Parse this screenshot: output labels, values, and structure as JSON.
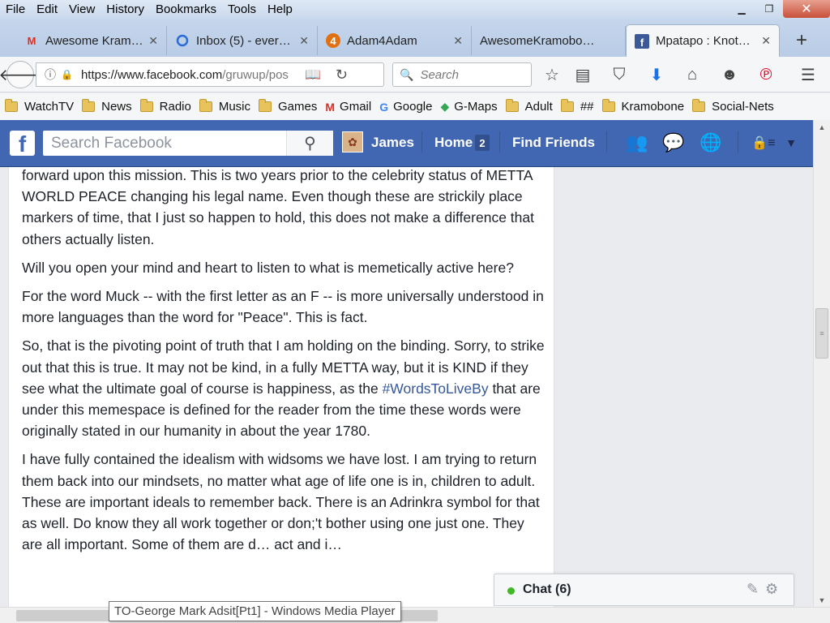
{
  "browser": {
    "menu": [
      "File",
      "Edit",
      "View",
      "History",
      "Bookmarks",
      "Tools",
      "Help"
    ],
    "tabs": [
      {
        "title": "Awesome Kram…",
        "icon": "gmail-icon",
        "icon_text": "M",
        "icon_color": "#d93025",
        "active": false
      },
      {
        "title": "Inbox (5) - ever…",
        "icon": "mail-ring-icon",
        "icon_text": "◯",
        "icon_color": "#2a6bd6",
        "active": false
      },
      {
        "title": "Adam4Adam",
        "icon": "adam4adam-icon",
        "icon_text": "4",
        "icon_color": "#e07010",
        "active": false
      },
      {
        "title": "AwesomeKramobo…",
        "icon": "",
        "icon_text": "",
        "icon_color": "",
        "active": false
      },
      {
        "title": "Mpatapo : Knot…",
        "icon": "facebook-icon",
        "icon_text": "f",
        "icon_color": "#3b5998",
        "active": true
      }
    ],
    "new_tab": "+",
    "url_main": "https://www.facebook.com",
    "url_rest": "/gruwup/pos",
    "search_placeholder": "Search",
    "bookmarks": [
      {
        "label": "WatchTV",
        "type": "folder"
      },
      {
        "label": "News",
        "type": "folder"
      },
      {
        "label": "Radio",
        "type": "folder"
      },
      {
        "label": "Music",
        "type": "folder"
      },
      {
        "label": "Games",
        "type": "folder"
      },
      {
        "label": "Gmail",
        "type": "gmail"
      },
      {
        "label": "Google",
        "type": "google"
      },
      {
        "label": "G-Maps",
        "type": "maps"
      },
      {
        "label": "Adult",
        "type": "folder"
      },
      {
        "label": "##",
        "type": "folder"
      },
      {
        "label": "Kramobone",
        "type": "folder"
      },
      {
        "label": "Social-Nets",
        "type": "folder"
      }
    ]
  },
  "facebook": {
    "search_placeholder": "Search Facebook",
    "user_name": "James",
    "home_label": "Home",
    "home_count": "2",
    "find_friends": "Find Friends",
    "brand_color": "#4267b2"
  },
  "post": {
    "paragraphs": [
      {
        "text": "forward upon this mission. This is two years prior to the celebrity status of METTA WORLD PEACE changing his legal name. Even though these are strickily place markers of time, that I just so happen to hold, this does not make a difference that others actually listen."
      },
      {
        "text": "Will you open your mind and heart to listen to what is memetically active here?"
      },
      {
        "text": "For the word Muck -- with the first letter as an F -- is more universally understood in more languages than the word for \"Peace\". This is fact."
      },
      {
        "before": "So, that is the pivoting point of truth that I am holding on the binding. Sorry, to strike out that this is true. It may not be kind, in a fully METTA way, but it is KIND if they see what the ultimate goal of course is happiness, as the ",
        "hashtag": "#WordsToLiveBy",
        "after": " that are under this memespace is defined for the reader from the time these words were originally stated in our humanity in about the year 1780."
      },
      {
        "text": "I have fully contained the idealism with widsoms we have lost. I am trying to return them back into our mindsets, no matter what age of life one is in, children to adult. These are important ideals to remember back. There is an Adrinkra symbol for that as well. Do know they all work together or don;'t bother using one just one. They are all important. Some of them are d… act and i… "
      }
    ]
  },
  "chat": {
    "label": "Chat (6)"
  },
  "tooltip": "TO-George Mark Adsit[Pt1]  - Windows Media Player"
}
